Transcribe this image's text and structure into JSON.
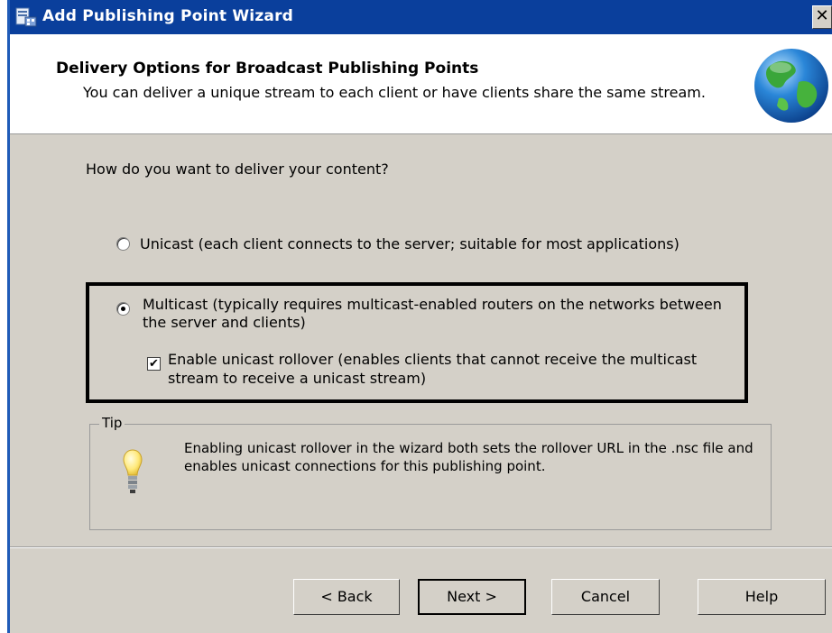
{
  "window": {
    "title": "Add Publishing Point Wizard",
    "close_glyph": "✕"
  },
  "header": {
    "title": "Delivery Options for Broadcast Publishing Points",
    "description": "You can deliver a unique stream to each client or have clients share the same stream.",
    "icon": "globe-icon"
  },
  "main": {
    "question": "How do you want to deliver your content?",
    "options": [
      {
        "label": "Unicast (each client connects to the server; suitable for most applications)",
        "selected": false
      },
      {
        "label": "Multicast (typically requires multicast-enabled routers on the networks between the server and clients)",
        "selected": true
      }
    ],
    "rollover": {
      "label": "Enable unicast rollover (enables clients that cannot receive the multicast stream to receive a unicast stream)",
      "checked": true,
      "check_glyph": "✔"
    }
  },
  "tip": {
    "legend": "Tip",
    "text": "Enabling unicast rollover in the wizard both sets the rollover URL in the .nsc file and enables unicast connections for this publishing point.",
    "icon": "lightbulb-icon"
  },
  "buttons": {
    "back": "< Back",
    "next": "Next >",
    "cancel": "Cancel",
    "help": "Help"
  },
  "colors": {
    "titlebar": "#0a3f9c",
    "dialog_bg": "#d4d0c8",
    "highlight_border": "#000000"
  }
}
